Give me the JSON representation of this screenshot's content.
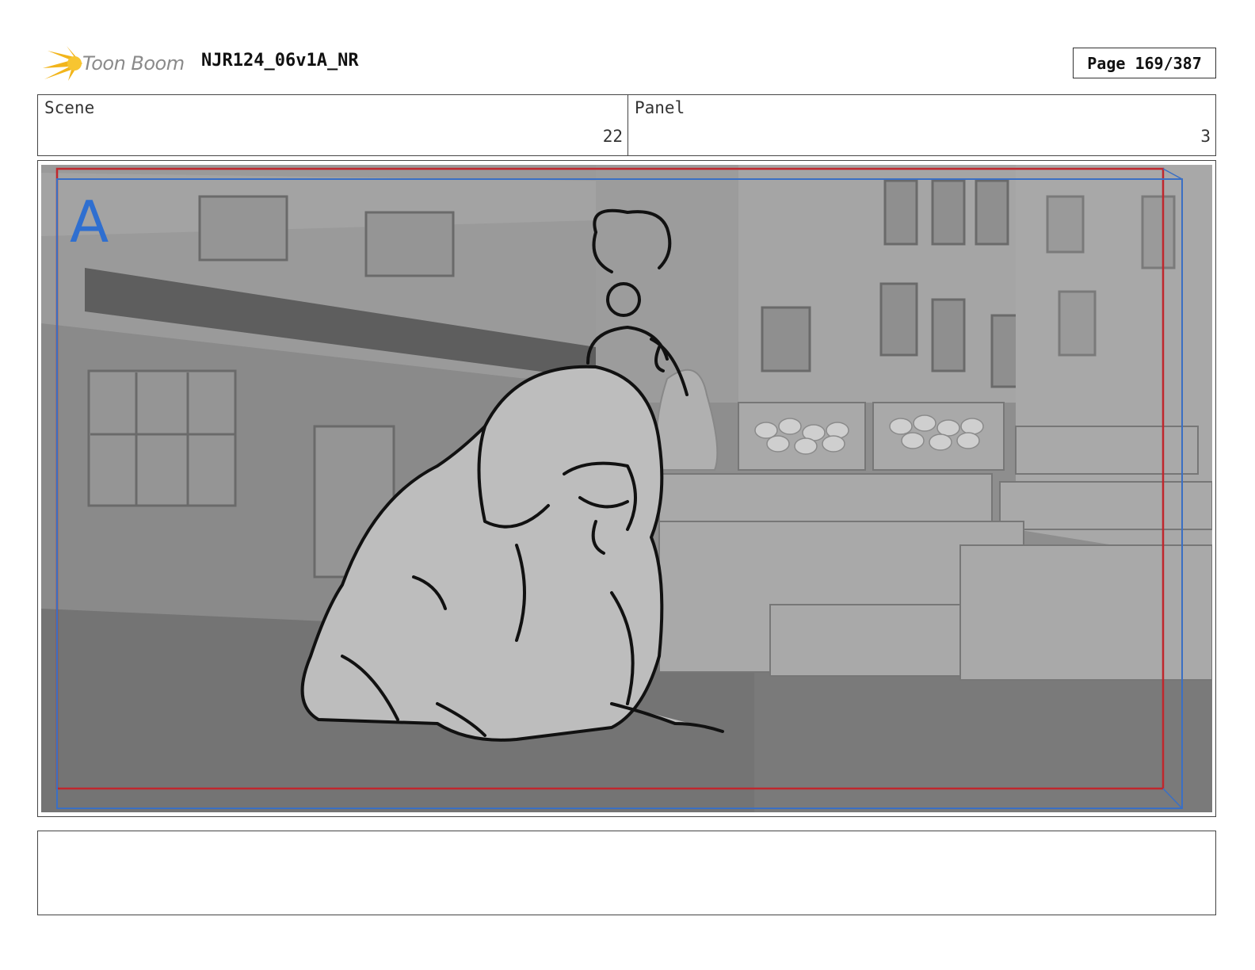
{
  "header": {
    "logo_text": "Toon Boom",
    "project_title": "NJR124_06v1A_NR",
    "page_label": "Page 169/387"
  },
  "info": {
    "scene_label": "Scene",
    "scene_value": "22",
    "panel_label": "Panel",
    "panel_value": "3"
  },
  "frame": {
    "layer_letter": "A"
  },
  "colors": {
    "logo_star": "#f2b51c",
    "safe_frame_red": "#c0272d",
    "camera_frame_blue": "#3a6fc4",
    "layer_letter": "#2f6fd0"
  },
  "notes": {
    "text": ""
  }
}
